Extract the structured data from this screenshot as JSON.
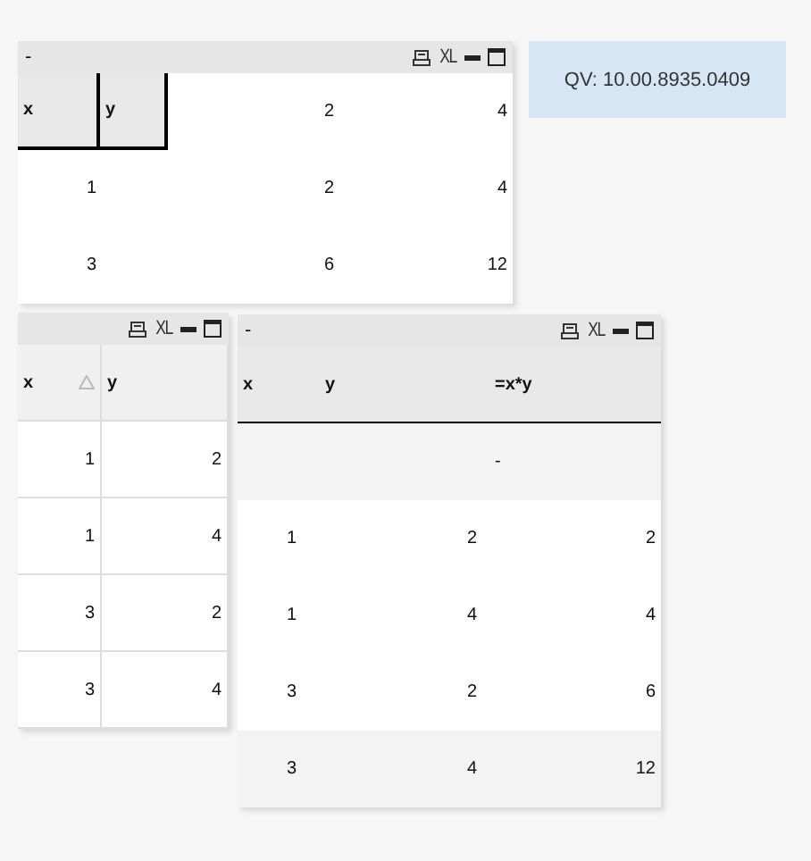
{
  "pivot_table": {
    "caption": "-",
    "export_label": "XL",
    "header": [
      "x",
      "y",
      "2",
      "4"
    ],
    "rows": [
      [
        "1",
        "2",
        "4"
      ],
      [
        "3",
        "6",
        "12"
      ]
    ]
  },
  "sorted_table": {
    "export_label": "XL",
    "columns": [
      {
        "label": "x",
        "sorted": true
      },
      {
        "label": "y",
        "sorted": false
      }
    ],
    "rows": [
      [
        "1",
        "2"
      ],
      [
        "1",
        "4"
      ],
      [
        "3",
        "2"
      ],
      [
        "3",
        "4"
      ]
    ]
  },
  "straight_table": {
    "caption": "-",
    "export_label": "XL",
    "columns": [
      "x",
      "y",
      "=x*y"
    ],
    "total": "-",
    "rows": [
      {
        "cells": [
          "1",
          "2",
          "2"
        ],
        "shaded": false
      },
      {
        "cells": [
          "1",
          "4",
          "4"
        ],
        "shaded": false
      },
      {
        "cells": [
          "3",
          "2",
          "6"
        ],
        "shaded": false
      },
      {
        "cells": [
          "3",
          "4",
          "12"
        ],
        "shaded": true
      }
    ]
  },
  "version_box": {
    "text": "QV: 10.00.8935.0409"
  }
}
